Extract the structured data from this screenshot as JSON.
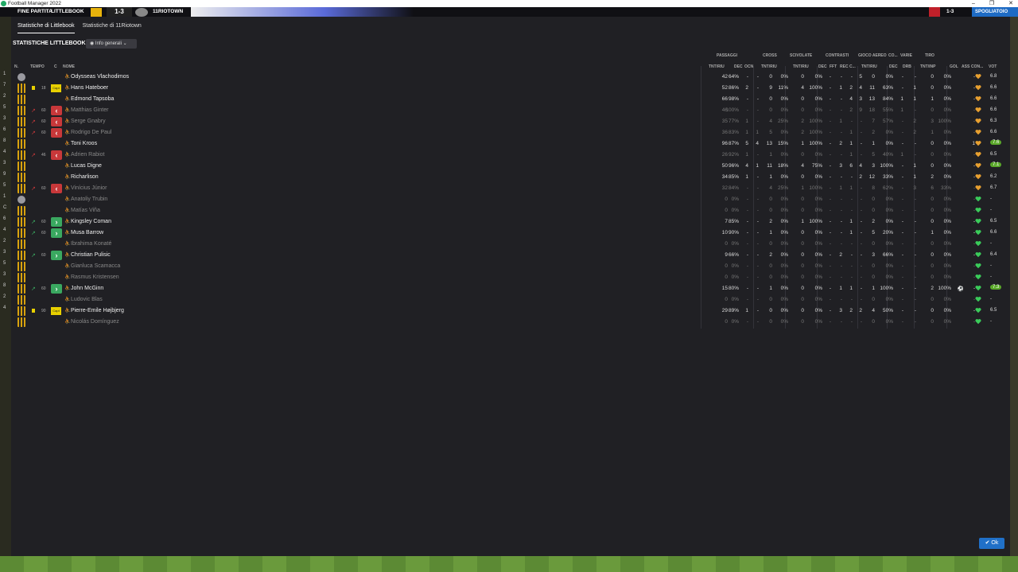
{
  "window": {
    "title": "Football Manager 2022",
    "controls": [
      "–",
      "❐",
      "✕"
    ]
  },
  "match": {
    "status": "FINE PARTITA",
    "home": "LITTLEBOOK",
    "score": "1-3",
    "away": "11RIOTOWN",
    "right_score": "1-3",
    "right_label": "SPOGLIATOIO"
  },
  "tabs": [
    "Statistiche di Littlebook",
    "Statistiche di 11Riotown"
  ],
  "section_title": "STATISTICHE LITTLEBOOK",
  "view_select": "Info generali",
  "columns": {
    "left": [
      "N.",
      "TEMPO",
      "C",
      "NOME"
    ],
    "groups": [
      "PASSAGGI",
      "CROSS",
      "SCIVOLATE",
      "CONTRASTI",
      "GIOCO AEREO",
      "CO...",
      "VARIE",
      "TIRO"
    ],
    "sub": [
      "TNT/RIU",
      "DEC",
      "OCN",
      "TNT/RIU",
      "TNT/RIU",
      "DEC",
      "FFT",
      "REC",
      "C...",
      "TNT/RIU",
      "DEC",
      "DRB",
      "TNT/INP",
      "GOL",
      "ASS",
      "CON...",
      "VOT"
    ]
  },
  "players": [
    {
      "num": "1",
      "gk": true,
      "name": "Odysseas Vlachodimos",
      "pas": "42",
      "pasp": "64%",
      "dec": "-",
      "ocn": "-",
      "cr": "0",
      "crp": "0%",
      "sc": "0",
      "scp": "0%",
      "cdec": "-",
      "fft": "-",
      "rec": "-",
      "c": "5",
      "ae": "0",
      "aep": "0%",
      "co": "-",
      "drb": "-",
      "ti": "0",
      "tip": "0%",
      "gol": "",
      "ass": "-",
      "vot": "6.8",
      "dim": false
    },
    {
      "num": "7",
      "card": true,
      "tmin": "18",
      "cap": "Capt",
      "name": "Hans Hateboer",
      "pas": "52",
      "pasp": "86%",
      "dec": "2",
      "ocn": "-",
      "cr": "9",
      "crp": "11%",
      "sc": "4",
      "scp": "100%",
      "cdec": "-",
      "fft": "1",
      "rec": "2",
      "c": "4",
      "ae": "11",
      "aep": "63%",
      "co": "-",
      "drb": "1",
      "ti": "0",
      "tip": "0%",
      "gol": "",
      "ass": "-",
      "vot": "6.6"
    },
    {
      "num": "2",
      "name": "Edmond Tapsoba",
      "pas": "66",
      "pasp": "98%",
      "dec": "-",
      "ocn": "-",
      "cr": "0",
      "crp": "0%",
      "sc": "0",
      "scp": "0%",
      "cdec": "-",
      "fft": "-",
      "rec": "4",
      "c": "3",
      "ae": "13",
      "aep": "84%",
      "co": "1",
      "drb": "1",
      "ti": "1",
      "tip": "0%",
      "gol": "",
      "ass": "-",
      "vot": "6.6"
    },
    {
      "num": "5",
      "sub": "out",
      "tmin": "60",
      "name": "Matthias Ginter",
      "pas": "46",
      "pasp": "100%",
      "dec": "-",
      "ocn": "-",
      "cr": "0",
      "crp": "0%",
      "sc": "0",
      "scp": "0%",
      "cdec": "-",
      "fft": "-",
      "rec": "2",
      "c": "9",
      "ae": "18",
      "aep": "55%",
      "co": "1",
      "drb": "-",
      "ti": "0",
      "tip": "0%",
      "gol": "",
      "ass": "-",
      "vot": "6.6",
      "dim": true
    },
    {
      "num": "3",
      "sub": "out",
      "tmin": "60",
      "name": "Serge Gnabry",
      "pas": "35",
      "pasp": "77%",
      "dec": "1",
      "ocn": "-",
      "cr": "4",
      "crp": "25%",
      "sc": "2",
      "scp": "100%",
      "cdec": "-",
      "fft": "1",
      "rec": "-",
      "c": "-",
      "ae": "7",
      "aep": "57%",
      "co": "-",
      "drb": "2",
      "ti": "3",
      "tip": "100%",
      "gol": "",
      "ass": "-",
      "vot": "6.3",
      "dim": true
    },
    {
      "num": "6",
      "sub": "out",
      "tmin": "60",
      "name": "Rodrigo De Paul",
      "pas": "36",
      "pasp": "83%",
      "dec": "1",
      "ocn": "1",
      "cr": "5",
      "crp": "0%",
      "sc": "2",
      "scp": "100%",
      "cdec": "-",
      "fft": "-",
      "rec": "1",
      "c": "-",
      "ae": "2",
      "aep": "0%",
      "co": "-",
      "drb": "2",
      "ti": "1",
      "tip": "0%",
      "gol": "",
      "ass": "-",
      "vot": "6.6",
      "dim": true
    },
    {
      "num": "8",
      "name": "Toni Kroos",
      "pas": "96",
      "pasp": "87%",
      "dec": "5",
      "ocn": "4",
      "cr": "13",
      "crp": "15%",
      "sc": "1",
      "scp": "100%",
      "cdec": "-",
      "fft": "2",
      "rec": "1",
      "c": "-",
      "ae": "1",
      "aep": "0%",
      "co": "-",
      "drb": "-",
      "ti": "0",
      "tip": "0%",
      "gol": "",
      "ass": "1",
      "vot": "7.6",
      "good": true
    },
    {
      "num": "4",
      "sub": "out",
      "tmin": "46",
      "name": "Adrien Rabiot",
      "pas": "26",
      "pasp": "92%",
      "dec": "1",
      "ocn": "-",
      "cr": "1",
      "crp": "0%",
      "sc": "0",
      "scp": "0%",
      "cdec": "-",
      "fft": "-",
      "rec": "1",
      "c": "-",
      "ae": "5",
      "aep": "40%",
      "co": "1",
      "drb": "-",
      "ti": "0",
      "tip": "0%",
      "gol": "",
      "ass": "-",
      "vot": "6.5",
      "dim": true
    },
    {
      "num": "3",
      "name": "Lucas Digne",
      "pas": "50",
      "pasp": "96%",
      "dec": "4",
      "ocn": "1",
      "cr": "11",
      "crp": "18%",
      "sc": "4",
      "scp": "75%",
      "cdec": "-",
      "fft": "3",
      "rec": "6",
      "c": "4",
      "ae": "3",
      "aep": "100%",
      "co": "-",
      "drb": "1",
      "ti": "0",
      "tip": "0%",
      "gol": "",
      "ass": "-",
      "vot": "7.1",
      "good": true
    },
    {
      "num": "9",
      "name": "Richarlison",
      "pas": "34",
      "pasp": "85%",
      "dec": "1",
      "ocn": "-",
      "cr": "1",
      "crp": "0%",
      "sc": "0",
      "scp": "0%",
      "cdec": "-",
      "fft": "-",
      "rec": "-",
      "c": "2",
      "ae": "12",
      "aep": "33%",
      "co": "-",
      "drb": "1",
      "ti": "2",
      "tip": "0%",
      "gol": "",
      "ass": "-",
      "vot": "6.2"
    },
    {
      "num": "5",
      "sub": "out",
      "tmin": "60",
      "name": "Vinícius Júnior",
      "pas": "32",
      "pasp": "84%",
      "dec": "-",
      "ocn": "-",
      "cr": "4",
      "crp": "25%",
      "sc": "1",
      "scp": "100%",
      "cdec": "-",
      "fft": "1",
      "rec": "1",
      "c": "-",
      "ae": "8",
      "aep": "62%",
      "co": "-",
      "drb": "3",
      "ti": "6",
      "tip": "33%",
      "gol": "",
      "ass": "-",
      "vot": "6.7",
      "dim": true
    },
    {
      "num": "1",
      "gk": true,
      "name": "Anatoliy Trubin",
      "pas": "0",
      "pasp": "0%",
      "dec": "-",
      "ocn": "-",
      "cr": "0",
      "crp": "0%",
      "sc": "0",
      "scp": "0%",
      "cdec": "-",
      "fft": "-",
      "rec": "-",
      "c": "-",
      "ae": "0",
      "aep": "0%",
      "co": "-",
      "drb": "-",
      "ti": "0",
      "tip": "0%",
      "gol": "",
      "ass": "-",
      "vot": "-",
      "dim": true
    },
    {
      "num": "C",
      "name": "Matías Viña",
      "pas": "0",
      "pasp": "0%",
      "dec": "-",
      "ocn": "-",
      "cr": "0",
      "crp": "0%",
      "sc": "0",
      "scp": "0%",
      "cdec": "-",
      "fft": "-",
      "rec": "-",
      "c": "-",
      "ae": "0",
      "aep": "0%",
      "co": "-",
      "drb": "-",
      "ti": "0",
      "tip": "0%",
      "gol": "",
      "ass": "-",
      "vot": "-",
      "dim": true
    },
    {
      "num": "6",
      "sub": "in",
      "tmin": "60",
      "name": "Kingsley Coman",
      "pas": "7",
      "pasp": "85%",
      "dec": "-",
      "ocn": "-",
      "cr": "2",
      "crp": "0%",
      "sc": "1",
      "scp": "100%",
      "cdec": "-",
      "fft": "-",
      "rec": "1",
      "c": "-",
      "ae": "2",
      "aep": "0%",
      "co": "-",
      "drb": "-",
      "ti": "0",
      "tip": "0%",
      "gol": "",
      "ass": "-",
      "vot": "6.5"
    },
    {
      "num": "4",
      "sub": "in",
      "tmin": "60",
      "name": "Musa Barrow",
      "pas": "10",
      "pasp": "90%",
      "dec": "-",
      "ocn": "-",
      "cr": "1",
      "crp": "0%",
      "sc": "0",
      "scp": "0%",
      "cdec": "-",
      "fft": "-",
      "rec": "1",
      "c": "-",
      "ae": "5",
      "aep": "20%",
      "co": "-",
      "drb": "-",
      "ti": "1",
      "tip": "0%",
      "gol": "",
      "ass": "-",
      "vot": "6.6"
    },
    {
      "num": "2",
      "name": "Ibrahima Konaté",
      "pas": "0",
      "pasp": "0%",
      "dec": "-",
      "ocn": "-",
      "cr": "0",
      "crp": "0%",
      "sc": "0",
      "scp": "0%",
      "cdec": "-",
      "fft": "-",
      "rec": "-",
      "c": "-",
      "ae": "0",
      "aep": "0%",
      "co": "-",
      "drb": "-",
      "ti": "0",
      "tip": "0%",
      "gol": "",
      "ass": "-",
      "vot": "-",
      "dim": true
    },
    {
      "num": "3",
      "sub": "in",
      "tmin": "60",
      "name": "Christian Pulisic",
      "pas": "9",
      "pasp": "66%",
      "dec": "-",
      "ocn": "-",
      "cr": "2",
      "crp": "0%",
      "sc": "0",
      "scp": "0%",
      "cdec": "-",
      "fft": "2",
      "rec": "-",
      "c": "-",
      "ae": "3",
      "aep": "66%",
      "co": "-",
      "drb": "-",
      "ti": "0",
      "tip": "0%",
      "gol": "",
      "ass": "-",
      "vot": "6.4"
    },
    {
      "num": "5",
      "name": "Gianluca Scamacca",
      "pas": "0",
      "pasp": "0%",
      "dec": "-",
      "ocn": "-",
      "cr": "0",
      "crp": "0%",
      "sc": "0",
      "scp": "0%",
      "cdec": "-",
      "fft": "-",
      "rec": "-",
      "c": "-",
      "ae": "0",
      "aep": "0%",
      "co": "-",
      "drb": "-",
      "ti": "0",
      "tip": "0%",
      "gol": "",
      "ass": "-",
      "vot": "-",
      "dim": true
    },
    {
      "num": "3",
      "name": "Rasmus Kristensen",
      "pas": "0",
      "pasp": "0%",
      "dec": "-",
      "ocn": "-",
      "cr": "0",
      "crp": "0%",
      "sc": "0",
      "scp": "0%",
      "cdec": "-",
      "fft": "-",
      "rec": "-",
      "c": "-",
      "ae": "0",
      "aep": "0%",
      "co": "-",
      "drb": "-",
      "ti": "0",
      "tip": "0%",
      "gol": "",
      "ass": "-",
      "vot": "-",
      "dim": true
    },
    {
      "num": "8",
      "sub": "in",
      "tmin": "60",
      "name": "John McGinn",
      "pas": "15",
      "pasp": "80%",
      "dec": "-",
      "ocn": "-",
      "cr": "1",
      "crp": "0%",
      "sc": "0",
      "scp": "0%",
      "cdec": "-",
      "fft": "1",
      "rec": "1",
      "c": "-",
      "ae": "1",
      "aep": "100%",
      "co": "-",
      "drb": "-",
      "ti": "2",
      "tip": "100%",
      "gol": "⚽",
      "ass": "-",
      "vot": "7.3",
      "good": true
    },
    {
      "num": "2",
      "name": "Ludovic Blas",
      "pas": "0",
      "pasp": "0%",
      "dec": "-",
      "ocn": "-",
      "cr": "0",
      "crp": "0%",
      "sc": "0",
      "scp": "0%",
      "cdec": "-",
      "fft": "-",
      "rec": "-",
      "c": "-",
      "ae": "0",
      "aep": "0%",
      "co": "-",
      "drb": "-",
      "ti": "0",
      "tip": "0%",
      "gol": "",
      "ass": "-",
      "vot": "-",
      "dim": true
    },
    {
      "num": "4",
      "card": true,
      "tmin": "90",
      "cap": "Capt",
      "name": "Pierre-Emile Højbjerg",
      "pas": "29",
      "pasp": "89%",
      "dec": "1",
      "ocn": "-",
      "cr": "0",
      "crp": "0%",
      "sc": "0",
      "scp": "0%",
      "cdec": "-",
      "fft": "3",
      "rec": "2",
      "c": "2",
      "ae": "4",
      "aep": "50%",
      "co": "-",
      "drb": "-",
      "ti": "0",
      "tip": "0%",
      "gol": "",
      "ass": "-",
      "vot": "6.5"
    },
    {
      "num": "",
      "name": "Nicolás Domínguez",
      "pas": "0",
      "pasp": "0%",
      "dec": "-",
      "ocn": "-",
      "cr": "0",
      "crp": "0%",
      "sc": "0",
      "scp": "0%",
      "cdec": "-",
      "fft": "-",
      "rec": "-",
      "c": "-",
      "ae": "0",
      "aep": "0%",
      "co": "-",
      "drb": "-",
      "ti": "0",
      "tip": "0%",
      "gol": "",
      "ass": "-",
      "vot": "-",
      "dim": true
    }
  ],
  "ok_label": "✔ Ok"
}
